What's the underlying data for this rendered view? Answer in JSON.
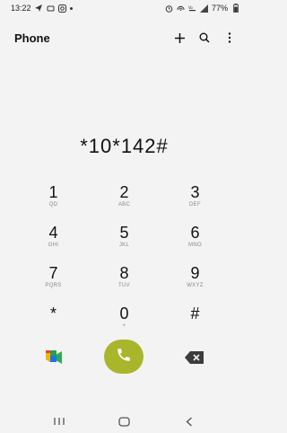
{
  "status_bar": {
    "time": "13:22",
    "battery": "77%",
    "left_icons": [
      "navigation-icon",
      "sync-icon",
      "instagram-icon",
      "dot-icon"
    ],
    "right_icons": [
      "alarm-icon",
      "hotspot-icon",
      "wifi-calling-icon",
      "signal-icon",
      "battery-icon"
    ]
  },
  "app_bar": {
    "title": "Phone",
    "actions": [
      "add-icon",
      "search-icon",
      "more-vert-icon"
    ]
  },
  "dialer": {
    "number": "*10*142#"
  },
  "keypad": {
    "keys": [
      {
        "digit": "1",
        "letters": "QD"
      },
      {
        "digit": "2",
        "letters": "ABC"
      },
      {
        "digit": "3",
        "letters": "DEF"
      },
      {
        "digit": "4",
        "letters": "GHI"
      },
      {
        "digit": "5",
        "letters": "JKL"
      },
      {
        "digit": "6",
        "letters": "MNO"
      },
      {
        "digit": "7",
        "letters": "PQRS"
      },
      {
        "digit": "8",
        "letters": "TUV"
      },
      {
        "digit": "9",
        "letters": "WXYZ"
      },
      {
        "digit": "*",
        "letters": ""
      },
      {
        "digit": "0",
        "letters": "+"
      },
      {
        "digit": "#",
        "letters": ""
      }
    ]
  },
  "colors": {
    "call_button": "#a9b62c",
    "background": "#f3f3f3"
  },
  "nav_bar": {
    "icons": [
      "recents-icon",
      "home-icon",
      "back-icon"
    ]
  }
}
